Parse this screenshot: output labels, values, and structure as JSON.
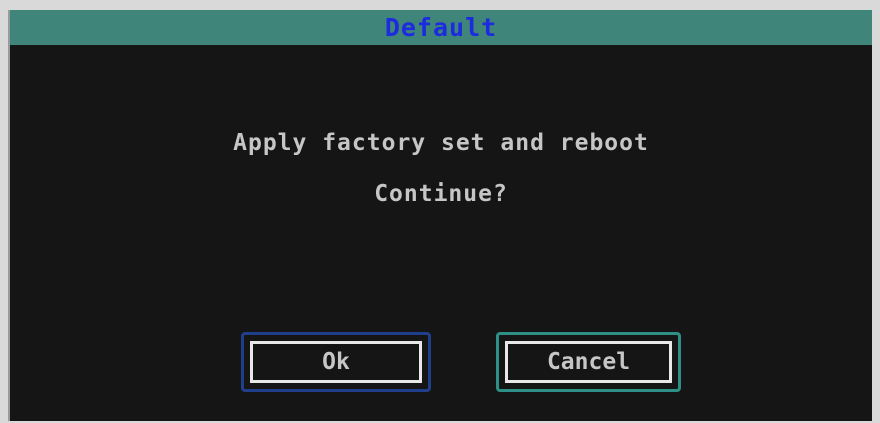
{
  "dialog": {
    "title": "Default",
    "message_line1": "Apply factory set and reboot",
    "message_line2": "Continue?",
    "ok_label": "Ok",
    "cancel_label": "Cancel"
  },
  "colors": {
    "title_bar": "#3f8579",
    "title_text": "#1d2be0",
    "background": "#151515",
    "text": "#c6c6c6",
    "ok_focus_border": "#1f3f8c",
    "cancel_focus_border": "#2d8f86"
  }
}
